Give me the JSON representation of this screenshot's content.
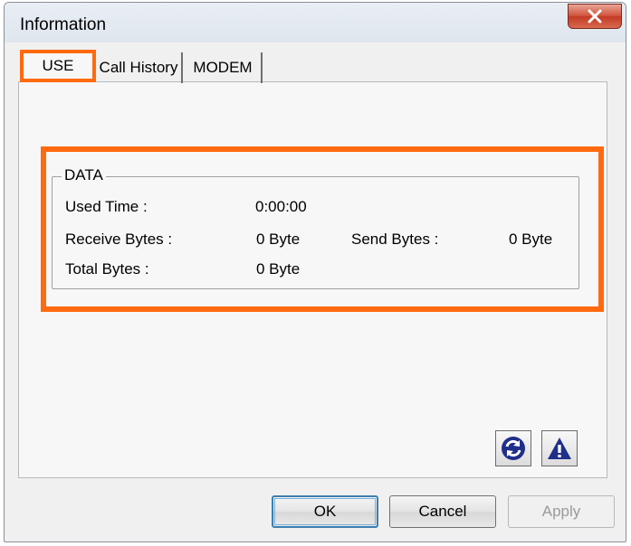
{
  "window": {
    "title": "Information"
  },
  "tabs": [
    {
      "label": "USE"
    },
    {
      "label": "Call History"
    },
    {
      "label": "MODEM"
    }
  ],
  "data_group": {
    "title": "DATA",
    "used_time_label": "Used Time :",
    "used_time_value": "0:00:00",
    "receive_label": "Receive Bytes :",
    "receive_value": "0 Byte",
    "send_label": "Send Bytes :",
    "send_value": "0 Byte",
    "total_label": "Total Bytes :",
    "total_value": "0 Byte"
  },
  "icons": {
    "refresh": "refresh-icon",
    "alert": "alert-icon",
    "close": "close-icon"
  },
  "buttons": {
    "ok": "OK",
    "cancel": "Cancel",
    "apply": "Apply"
  },
  "colors": {
    "highlight": "#ff6a10",
    "icon_blue": "#1f2f8a"
  }
}
